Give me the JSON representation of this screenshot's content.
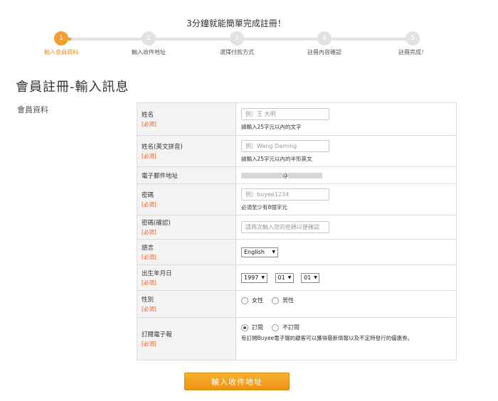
{
  "steps": {
    "title": "3分鐘就能簡單完成註冊！",
    "items": [
      {
        "num": "1",
        "label": "輸入會員資料"
      },
      {
        "num": "2",
        "label": "輸入收件地址"
      },
      {
        "num": "3",
        "label": "選擇付款方式"
      },
      {
        "num": "4",
        "label": "註冊內容確認"
      },
      {
        "num": "5",
        "label": "註冊完成！"
      }
    ]
  },
  "page_title": "會員註冊-輸入訊息",
  "section_label": "會員資料",
  "required_label": "[必須]",
  "form": {
    "name": {
      "label": "姓名",
      "placeholder": "例）王 大明",
      "hint": "請輸入25字元以內的文字"
    },
    "name_en": {
      "label": "姓名(英文拼音)",
      "placeholder": "例）Wang Daming",
      "hint": "請輸入25字元以內的半形英文"
    },
    "email": {
      "label": "電子郵件地址",
      "at": "@"
    },
    "password": {
      "label": "密碼",
      "placeholder": "例）buyee1234",
      "hint": "必須至少有8個字元"
    },
    "password_confirm": {
      "label": "密碼(確認)",
      "placeholder": "請再次輸入您的密碼以便確認"
    },
    "language": {
      "label": "語言",
      "value": "English"
    },
    "birthday": {
      "label": "出生年月日",
      "year": "1997",
      "month": "01",
      "day": "01"
    },
    "gender": {
      "label": "性別",
      "female": "女性",
      "male": "男性"
    },
    "newsletter": {
      "label": "訂閱電子報",
      "subscribe": "訂閱",
      "unsubscribe": "不訂閱",
      "hint": "有訂閱Buyee電子報的顧客可以獲得最新情報以及不定時發行的優惠券。"
    }
  },
  "submit_label": "輸入收件地址",
  "colors": {
    "accent": "#f0a030",
    "required": "#e25c2a",
    "label_bg": "#f3f3f3"
  }
}
